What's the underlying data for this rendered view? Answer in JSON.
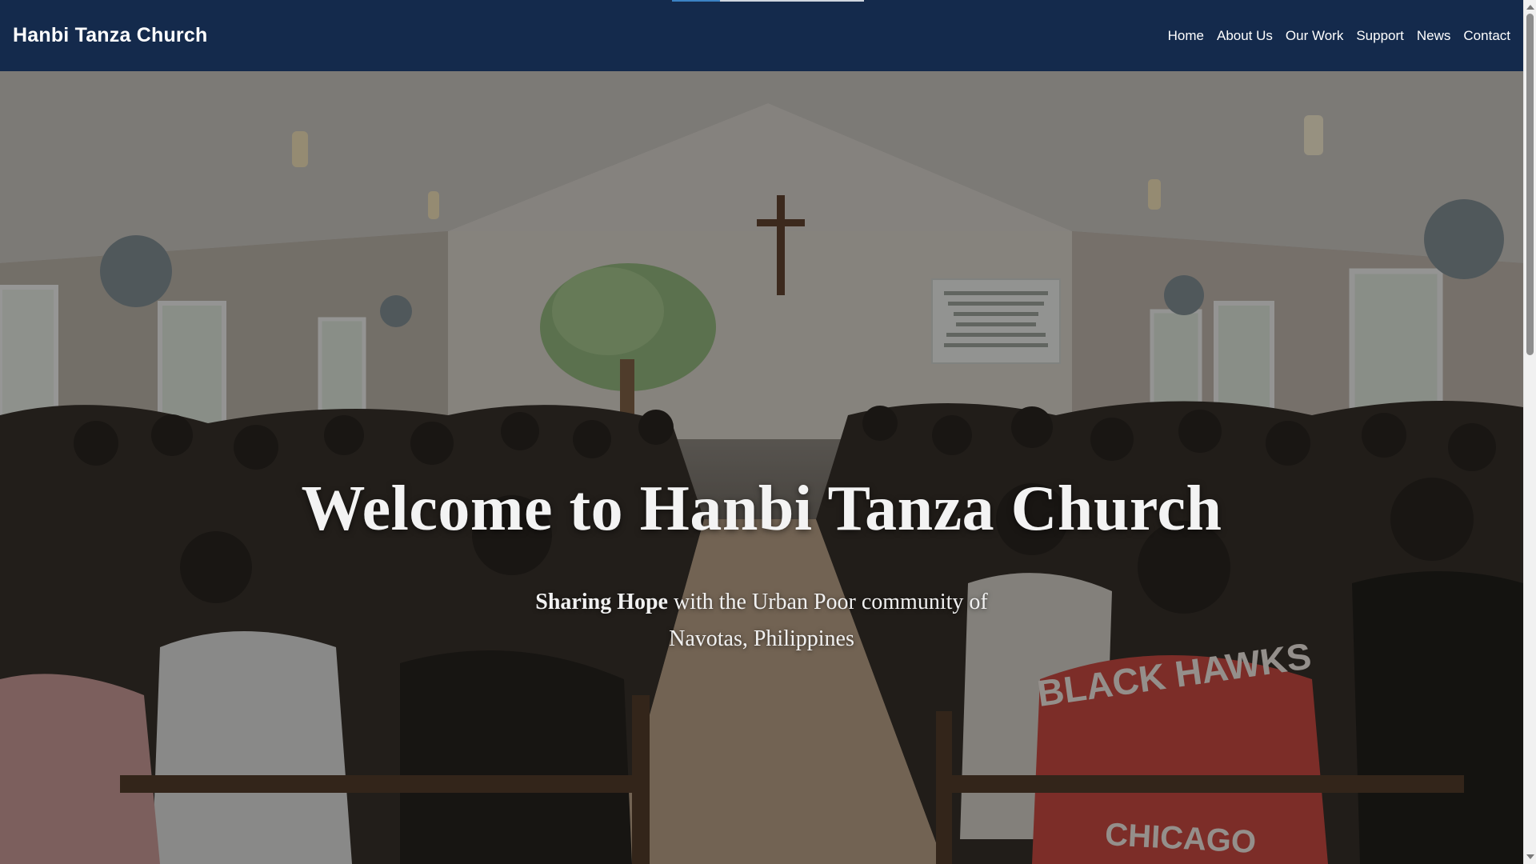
{
  "header": {
    "brand": "Hanbi Tanza Church",
    "nav": [
      "Home",
      "About Us",
      "Our Work",
      "Support",
      "News",
      "Contact"
    ]
  },
  "hero": {
    "title": "Welcome to Hanbi Tanza Church",
    "subtitle_bold": "Sharing Hope",
    "subtitle_rest": " with the Urban Poor community of Navotas, Philippines",
    "projector_text": "Our Father which art in heaven\nHallowed be Thy name\nThy Kingdom come\nThy will be done\nOn earth as it is in heaven\nGive us this day our daily bread",
    "shirt_text_top": "BLACK HAWKS",
    "shirt_text_bottom": "CHICAGO"
  },
  "reading_progress": 0.25,
  "colors": {
    "header_bg": "#142a4c",
    "accent": "#3b82c4",
    "text_light": "#ffffff"
  }
}
